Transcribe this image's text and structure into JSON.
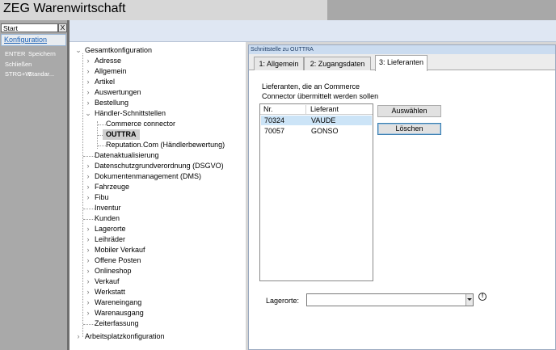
{
  "app": {
    "title": "ZEG Warenwirtschaft"
  },
  "left": {
    "start_value": "Start",
    "close_label": "X",
    "active_link": "Konfiguration",
    "shortcuts": [
      {
        "key": "ENTER",
        "action": "Speichern"
      },
      {
        "key": "",
        "action": "Schließen"
      },
      {
        "key": "STRG+W",
        "action": "Standar..."
      }
    ]
  },
  "tree": {
    "root": "Gesamtkonfiguration",
    "items": [
      "Adresse",
      "Allgemein",
      "Artikel",
      "Auswertungen",
      "Bestellung",
      "Händler-Schnittstellen",
      "Commerce connector",
      "OUTTRA",
      "Reputation.Com (Händlerbewertung)",
      "Datenaktualisierung",
      "Datenschutzgrundverordnung (DSGVO)",
      "Dokumentenmanagement (DMS)",
      "Fahrzeuge",
      "Fibu",
      "Inventur",
      "Kunden",
      "Lagerorte",
      "Leihräder",
      "Mobiler Verkauf",
      "Offene Posten",
      "Onlineshop",
      "Verkauf",
      "Werkstatt",
      "Wareneingang",
      "Warenausgang",
      "Zeiterfassung"
    ],
    "root2": "Arbeitsplatzkonfiguration"
  },
  "panel": {
    "title": "Schnittstelle zu OUTTRA",
    "tabs": [
      "1: Allgemein",
      "2: Zugangsdaten",
      "3: Lieferanten"
    ],
    "active_tab": "3: Lieferanten",
    "desc_line1": "Lieferanten, die an Commerce",
    "desc_line2": "Connector übermittelt werden sollen",
    "list": {
      "headers": [
        "Nr.",
        "Lieferant"
      ],
      "rows": [
        {
          "nr": "70324",
          "name": "VAUDE"
        },
        {
          "nr": "70057",
          "name": "GONSO"
        }
      ]
    },
    "buttons": {
      "select": "Auswählen",
      "delete": "Löschen"
    },
    "lagerorte_label": "Lagerorte:",
    "lagerorte_value": ""
  }
}
